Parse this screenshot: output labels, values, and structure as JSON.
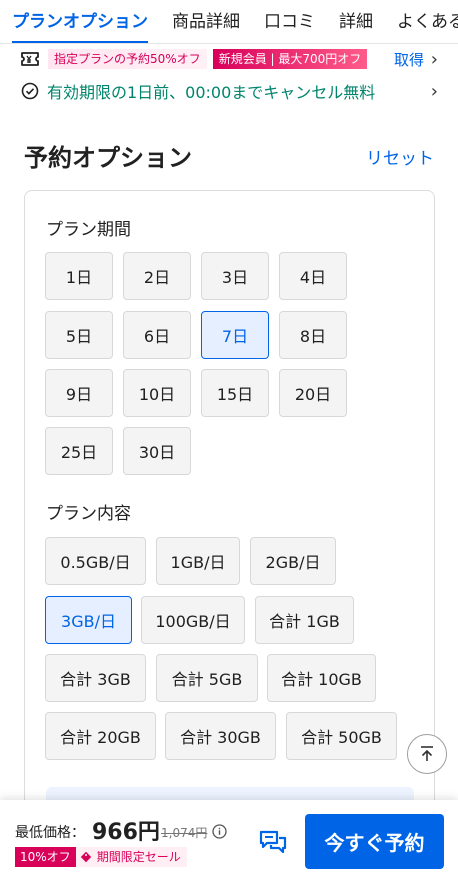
{
  "tabs": [
    {
      "label": "プランオプション",
      "active": true
    },
    {
      "label": "商品詳細",
      "active": false
    },
    {
      "label": "口コミ",
      "active": false
    },
    {
      "label": "詳細",
      "active": false
    },
    {
      "label": "よくある",
      "active": false
    }
  ],
  "promo": {
    "coupon_tag": "指定プランの予約50%オフ",
    "new_member_tag": "新規会員 | 最大700円オフ",
    "get_label": "取得",
    "cancel_text": "有効期限の1日前、00:00までキャンセル無料"
  },
  "options": {
    "title": "予約オプション",
    "reset_label": "リセット",
    "period_label": "プラン期間",
    "periods": [
      "1日",
      "2日",
      "3日",
      "4日",
      "5日",
      "6日",
      "7日",
      "8日",
      "9日",
      "10日",
      "15日",
      "20日",
      "25日",
      "30日"
    ],
    "selected_period": "7日",
    "content_label": "プラン内容",
    "contents": [
      "0.5GB/日",
      "1GB/日",
      "2GB/日",
      "3GB/日",
      "100GB/日",
      "合計 1GB",
      "合計 3GB",
      "合計 5GB",
      "合計 10GB",
      "合計 20GB",
      "合計 30GB",
      "合計 50GB"
    ],
    "selected_content": "3GB/日"
  },
  "footer": {
    "price_label": "最低価格：",
    "price": "966円",
    "original_price": "1,074円",
    "discount_badge": "10%オフ",
    "limited_label": "期間限定セール",
    "book_label": "今すぐ予約"
  },
  "icons": {
    "ticket": "ticket-icon",
    "check": "check-circle-icon",
    "info": "info-icon",
    "tag": "tag-icon",
    "chat": "chat-icon",
    "scroll_top": "arrow-up-to-top-icon"
  },
  "colors": {
    "accent": "#0064e6",
    "promo_pink": "#d9005a",
    "green": "#00856c"
  }
}
